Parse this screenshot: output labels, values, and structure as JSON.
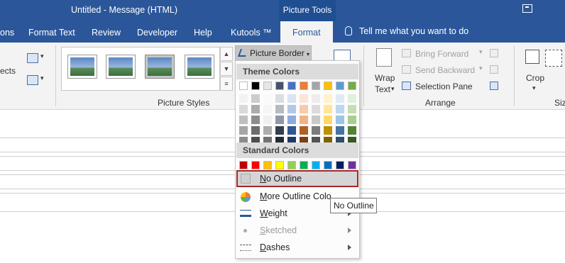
{
  "titlebar": {
    "title": "Untitled  -  Message (HTML)",
    "context_tab": "Picture Tools"
  },
  "tabs": {
    "items": [
      "ons",
      "Format Text",
      "Review",
      "Developer",
      "Help",
      "Kutools ™",
      "Format"
    ],
    "active": "Format",
    "tell_me": "Tell me what you want to do"
  },
  "ribbon": {
    "left_partial_label": "ects",
    "picture_styles_label": "Picture Styles",
    "picture_border_label": "Picture Border",
    "bring_forward": "Bring Forward",
    "send_backward": "Send Backward",
    "selection_pane": "Selection Pane",
    "wrap_text": "Wrap\nText",
    "wrap_line1": "Wrap",
    "wrap_line2": "Text",
    "arrange_label": "Arrange",
    "crop": "Crop",
    "size_partial": "Siz"
  },
  "menu": {
    "theme_colors_header": "Theme Colors",
    "standard_colors_header": "Standard Colors",
    "theme_colors": [
      "#ffffff",
      "#000000",
      "#e7e6e6",
      "#44546a",
      "#4472c4",
      "#ed7d31",
      "#a5a5a5",
      "#ffc000",
      "#5b9bd5",
      "#70ad47"
    ],
    "standard_colors": [
      "#c00000",
      "#ff0000",
      "#ffc000",
      "#ffff00",
      "#92d050",
      "#00b050",
      "#00b0f0",
      "#0070c0",
      "#002060",
      "#7030a0"
    ],
    "no_outline": "No Outline",
    "more_outline": "More Outline Colo",
    "weight": "Weight",
    "sketched": "Sketched",
    "dashes": "Dashes"
  },
  "tooltip": "No Outline"
}
